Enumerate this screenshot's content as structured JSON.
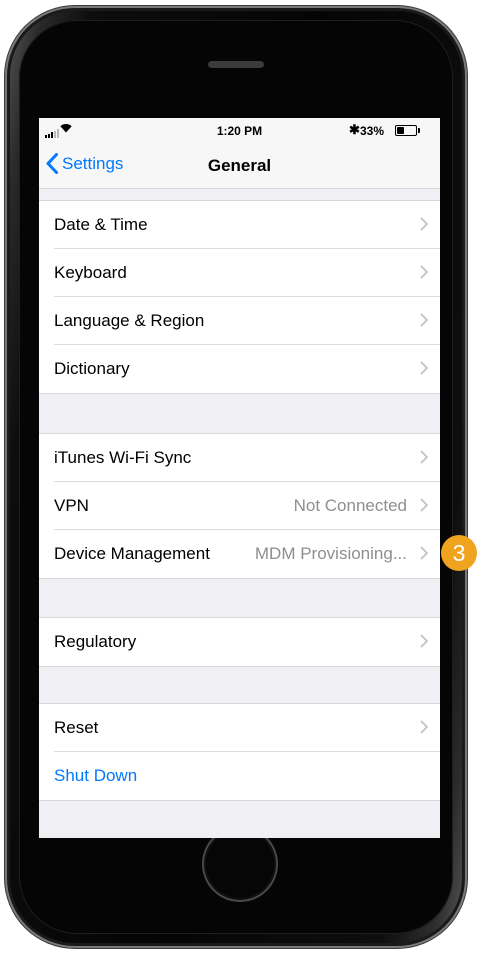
{
  "status_bar": {
    "time": "1:20 PM",
    "bluetooth_icon": "✱",
    "battery_percent": "33%",
    "battery_level": 0.33
  },
  "nav": {
    "back_label": "Settings",
    "title": "General"
  },
  "groups": [
    {
      "rows": [
        {
          "label": "Date & Time",
          "value": ""
        },
        {
          "label": "Keyboard",
          "value": ""
        },
        {
          "label": "Language & Region",
          "value": ""
        },
        {
          "label": "Dictionary",
          "value": ""
        }
      ]
    },
    {
      "rows": [
        {
          "label": "iTunes Wi-Fi Sync",
          "value": ""
        },
        {
          "label": "VPN",
          "value": "Not Connected"
        },
        {
          "label": "Device Management",
          "value": "MDM Provisioning..."
        }
      ]
    },
    {
      "rows": [
        {
          "label": "Regulatory",
          "value": ""
        }
      ]
    },
    {
      "rows": [
        {
          "label": "Reset",
          "value": ""
        },
        {
          "label": "Shut Down",
          "value": ""
        }
      ]
    }
  ],
  "callout": {
    "number": "3",
    "color": "#f0a31f"
  },
  "colors": {
    "accent": "#007aff",
    "background": "#efeff4"
  }
}
